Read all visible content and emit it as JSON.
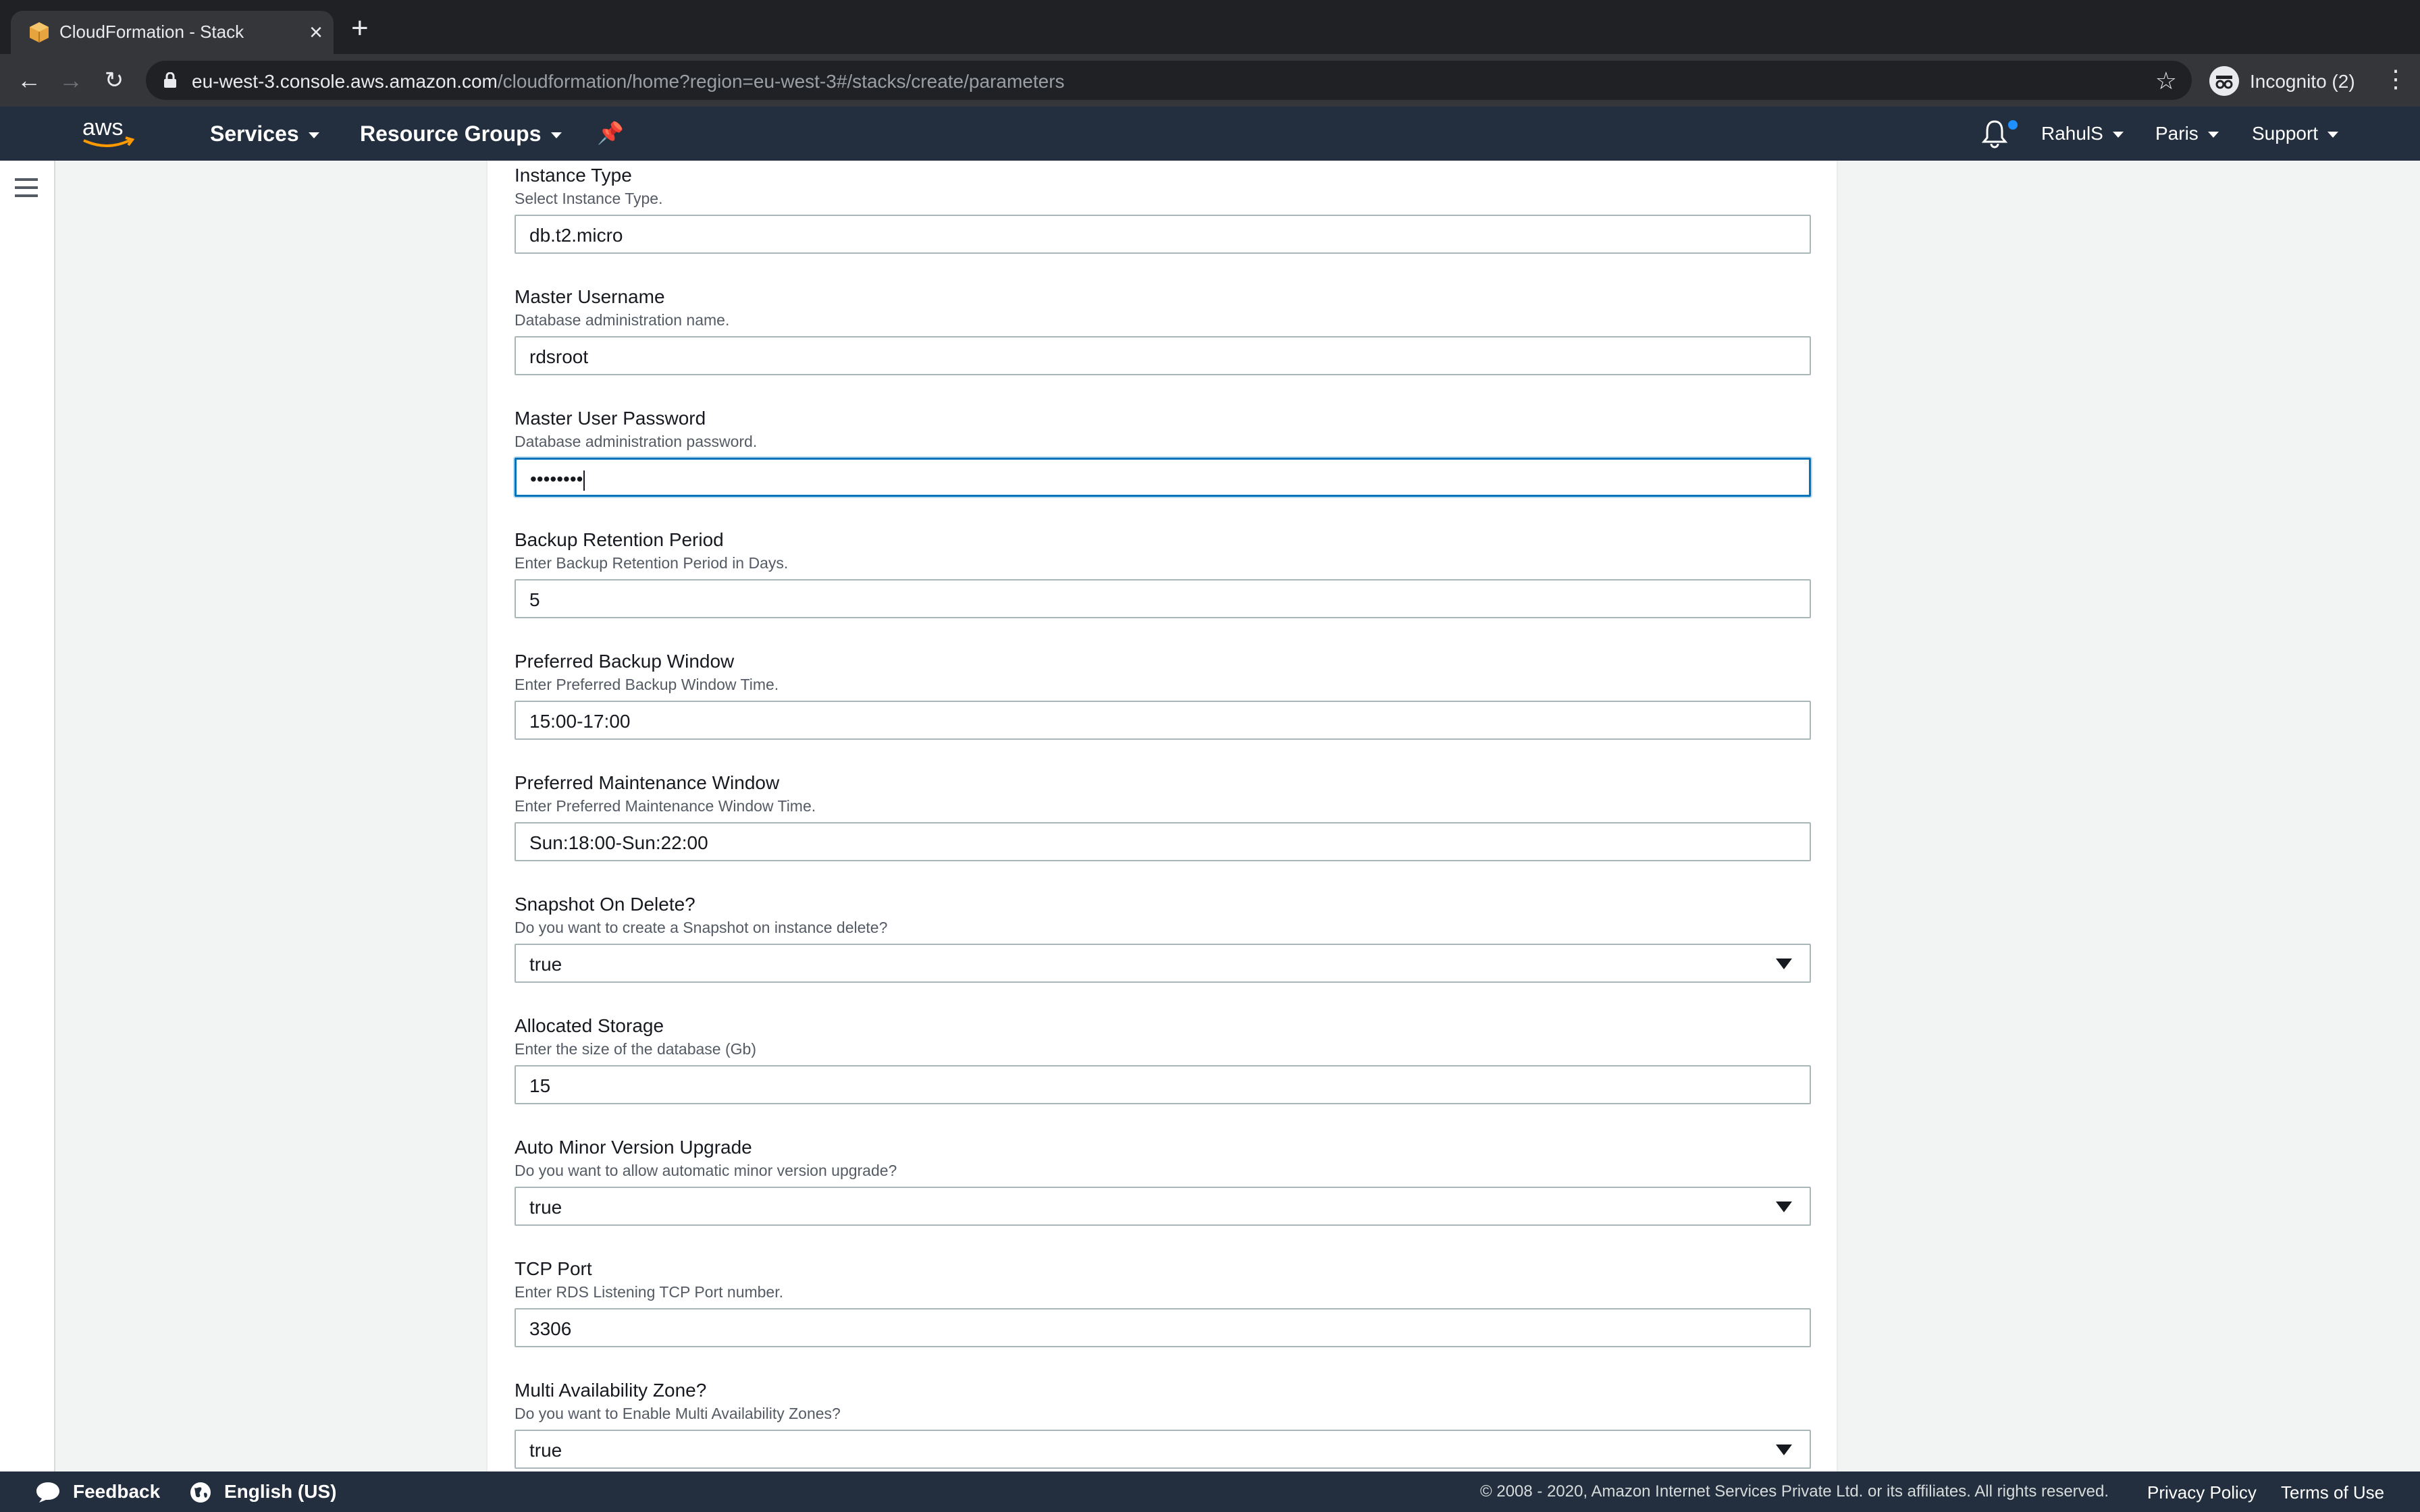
{
  "browser": {
    "tab_title": "CloudFormation - Stack",
    "url_host": "eu-west-3.console.aws.amazon.com",
    "url_path": "/cloudformation/home?region=eu-west-3#/stacks/create/parameters",
    "profile_label": "Incognito (2)"
  },
  "aws_nav": {
    "services": "Services",
    "resource_groups": "Resource Groups",
    "user": "RahulS",
    "region": "Paris",
    "support": "Support"
  },
  "form": {
    "fields": [
      {
        "label": "Instance Type",
        "description": "Select Instance Type.",
        "value": "db.t2.micro",
        "type": "text"
      },
      {
        "label": "Master Username",
        "description": "Database administration name.",
        "value": "rdsroot",
        "type": "text"
      },
      {
        "label": "Master User Password",
        "description": "Database administration password.",
        "value": "••••••••",
        "type": "password"
      },
      {
        "label": "Backup Retention Period",
        "description": "Enter Backup Retention Period in Days.",
        "value": "5",
        "type": "text"
      },
      {
        "label": "Preferred Backup Window",
        "description": "Enter Preferred Backup Window Time.",
        "value": "15:00-17:00",
        "type": "text"
      },
      {
        "label": "Preferred Maintenance Window",
        "description": "Enter Preferred Maintenance Window Time.",
        "value": "Sun:18:00-Sun:22:00",
        "type": "text"
      },
      {
        "label": "Snapshot On Delete?",
        "description": "Do you want to create a Snapshot on instance delete?",
        "value": "true",
        "type": "select"
      },
      {
        "label": "Allocated Storage",
        "description": "Enter the size of the database (Gb)",
        "value": "15",
        "type": "text"
      },
      {
        "label": "Auto Minor Version Upgrade",
        "description": "Do you want to allow automatic minor version upgrade?",
        "value": "true",
        "type": "select"
      },
      {
        "label": "TCP Port",
        "description": "Enter RDS Listening TCP Port number.",
        "value": "3306",
        "type": "text"
      },
      {
        "label": "Multi Availability Zone?",
        "description": "Do you want to Enable Multi Availability Zones?",
        "value": "true",
        "type": "select"
      }
    ]
  },
  "footer": {
    "feedback": "Feedback",
    "language": "English (US)",
    "copyright": "© 2008 - 2020, Amazon Internet Services Private Ltd. or its affiliates. All rights reserved.",
    "privacy": "Privacy Policy",
    "terms": "Terms of Use"
  },
  "colors": {
    "aws_nav_bg": "#232f3e",
    "focus_border": "#0073bb",
    "aws_orange": "#ff9900"
  }
}
